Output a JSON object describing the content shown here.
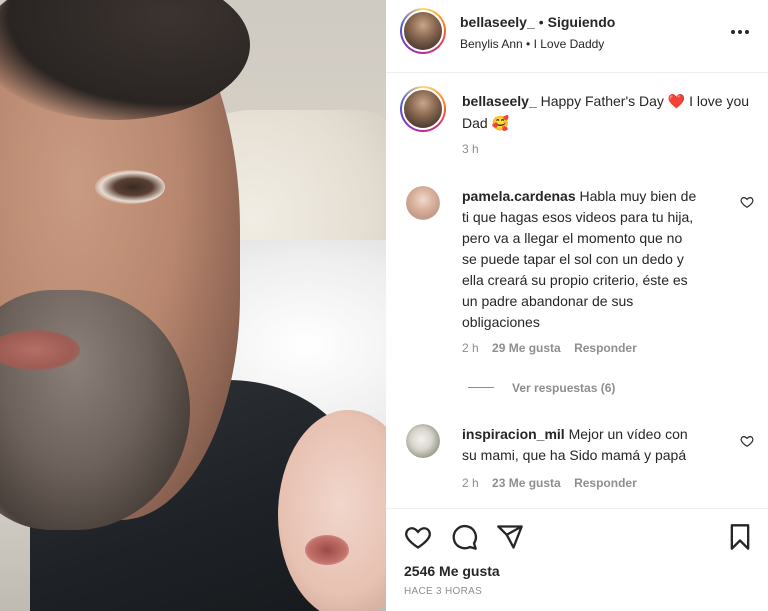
{
  "post": {
    "username": "bellaseely_",
    "follow_state": "Siguiendo",
    "audio": "Benylis Ann • I Love Daddy",
    "caption_text": "Happy Father's Day",
    "caption_heart": "❤️",
    "caption_text2": "I love you Dad",
    "caption_emoji": "🥰",
    "caption_time": "3 h"
  },
  "comments": [
    {
      "username": "pamela.cardenas",
      "line1": "Habla muy bien de",
      "line2": "ti que hagas esos videos para tu hija,",
      "line3": "pero va a llegar el momento que no",
      "line4": "se puede tapar el sol con un dedo y",
      "line5": "ella creará su propio criterio, éste es",
      "line6": "un padre abandonar de sus",
      "line7": "obligaciones",
      "time": "2 h",
      "likes": "29 Me gusta",
      "reply": "Responder",
      "view_replies": "Ver respuestas (6)"
    },
    {
      "username": "inspiracion_mil",
      "line1": "Mejor un vídeo con",
      "line2": "su mami, que ha Sido mamá y papá",
      "time": "2 h",
      "likes": "23 Me gusta",
      "reply": "Responder"
    }
  ],
  "footer": {
    "likes": "2546 Me gusta",
    "posted": "HACE 3 HORAS"
  },
  "icons": [
    "more-icon",
    "like-icon",
    "comment-icon",
    "share-icon",
    "save-icon",
    "comment-like-icon"
  ],
  "colors": {
    "text": "#262626",
    "meta": "#8e8e8e",
    "heart": "#ed4956"
  }
}
